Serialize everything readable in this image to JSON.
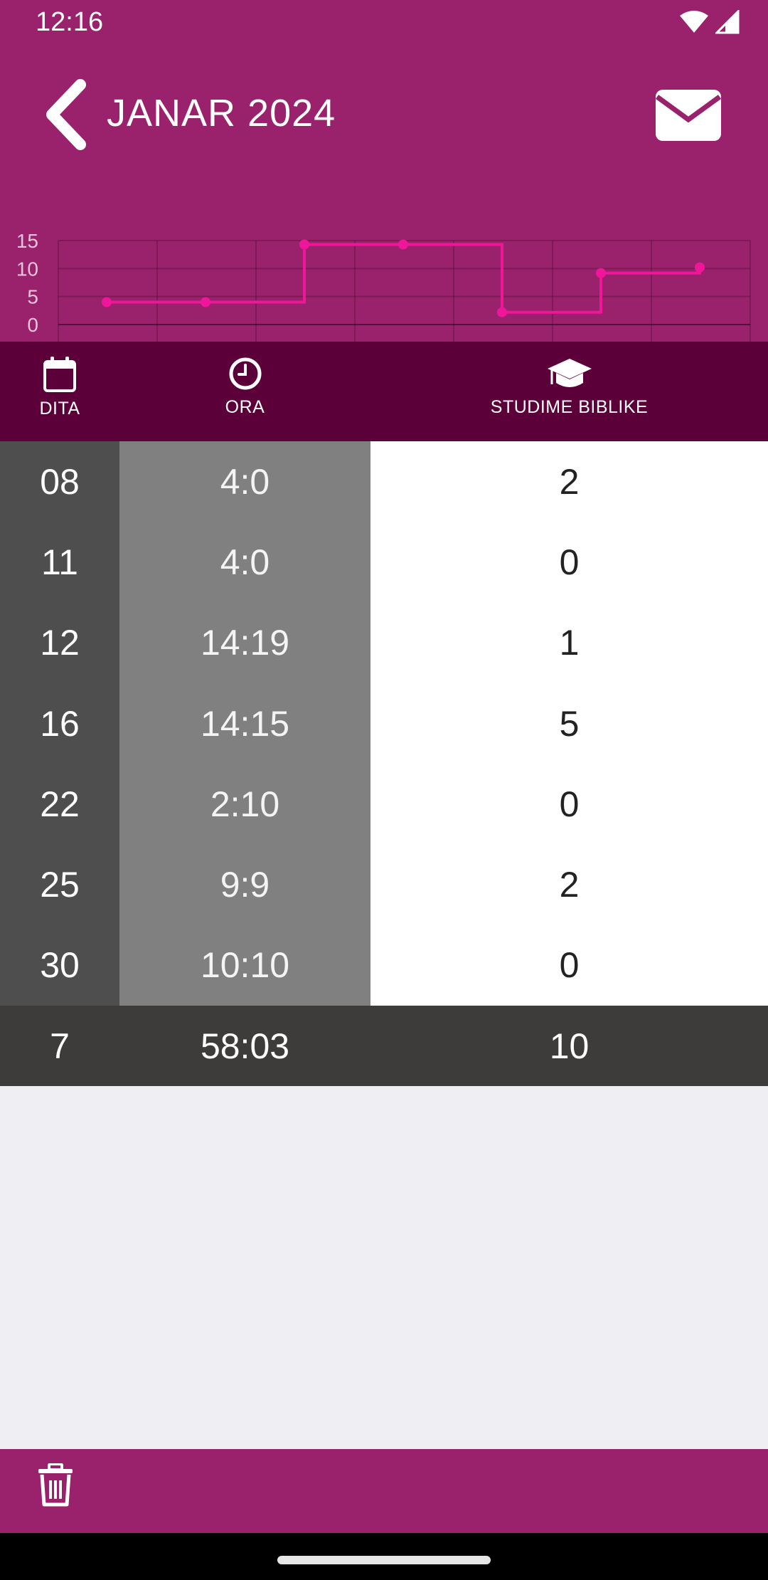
{
  "status_bar": {
    "time": "12:16"
  },
  "header": {
    "title": "JANAR 2024"
  },
  "chart_data": {
    "type": "line",
    "step": true,
    "categories": [
      "08",
      "11",
      "12",
      "16",
      "22",
      "25",
      "30"
    ],
    "values": [
      4,
      4,
      14.3,
      14.3,
      2.2,
      9.2,
      10.2
    ],
    "yticks": [
      "15",
      "10",
      "5",
      "0"
    ],
    "ylim": [
      0,
      15
    ],
    "grid": true,
    "line_color": "#f0169a"
  },
  "columns": {
    "day_label": "DITA",
    "hours_label": "ORA",
    "studies_label": "STUDIME BIBLIKE"
  },
  "rows": [
    {
      "day": "08",
      "hours": "4:0",
      "studies": "2"
    },
    {
      "day": "11",
      "hours": "4:0",
      "studies": "0"
    },
    {
      "day": "12",
      "hours": "14:19",
      "studies": "1"
    },
    {
      "day": "16",
      "hours": "14:15",
      "studies": "5"
    },
    {
      "day": "22",
      "hours": "2:10",
      "studies": "0"
    },
    {
      "day": "25",
      "hours": "9:9",
      "studies": "2"
    },
    {
      "day": "30",
      "hours": "10:10",
      "studies": "0"
    }
  ],
  "totals": {
    "days": "7",
    "hours": "58:03",
    "studies": "10"
  },
  "colors": {
    "primary": "#9a216b",
    "header_dark": "#5c003a",
    "day_col": "#4e4e4e",
    "hours_col": "#808080",
    "total_row": "#3d3c3a"
  }
}
